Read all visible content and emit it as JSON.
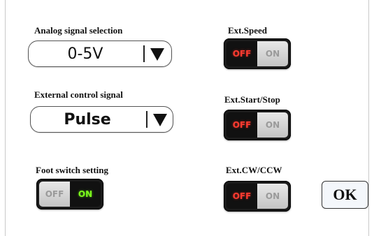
{
  "left_panel": {
    "analog": {
      "label": "Analog signal selection",
      "value": "0-5V"
    },
    "external_control": {
      "label": "External control signal",
      "value": "Pulse"
    },
    "foot_switch": {
      "label": "Foot switch setting",
      "off_label": "OFF",
      "on_label": "ON",
      "state": "ON"
    }
  },
  "right_panel": {
    "ext_speed": {
      "label": "Ext.Speed",
      "off_label": "OFF",
      "on_label": "ON",
      "state": "OFF"
    },
    "ext_start_stop": {
      "label": "Ext.Start/Stop",
      "off_label": "OFF",
      "on_label": "ON",
      "state": "OFF"
    },
    "ext_cw_ccw": {
      "label": "Ext.CW/CCW",
      "off_label": "OFF",
      "on_label": "ON",
      "state": "OFF"
    }
  },
  "ok_button": {
    "label": "OK"
  },
  "colors": {
    "off_active": "#ff3b30",
    "on_active": "#7cff1c",
    "toggle_body": "#1a1a1a"
  },
  "icons": {
    "dropdown": "triangle-down-icon"
  }
}
